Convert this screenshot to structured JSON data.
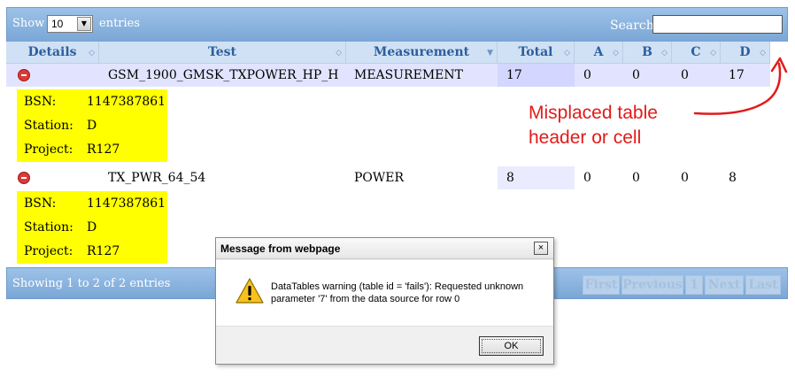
{
  "toolbar": {
    "show_label": "Show",
    "length_value": "10",
    "entries_label": "entries",
    "search_label": "Search:",
    "search_value": ""
  },
  "columns": [
    "Details",
    "Test",
    "Measurement",
    "Total",
    "A",
    "B",
    "C",
    "D"
  ],
  "rows": [
    {
      "test": "GSM_1900_GMSK_TXPOWER_HP_H",
      "measurement": "MEASUREMENT",
      "total": "17",
      "a": "0",
      "b": "0",
      "c": "0",
      "d": "17",
      "details": {
        "bsn_label": "BSN:",
        "bsn": "1147387861",
        "station_label": "Station:",
        "station": "D",
        "project_label": "Project:",
        "project": "R127"
      }
    },
    {
      "test": "TX_PWR_64_54",
      "measurement": "POWER",
      "total": "8",
      "a": "0",
      "b": "0",
      "c": "0",
      "d": "8",
      "details": {
        "bsn_label": "BSN:",
        "bsn": "1147387861",
        "station_label": "Station:",
        "station": "D",
        "project_label": "Project:",
        "project": "R127"
      }
    }
  ],
  "footer": {
    "info": "Showing 1 to 2 of 2 entries",
    "first": "First",
    "previous": "Previous",
    "page": "1",
    "next": "Next",
    "last": "Last"
  },
  "annotation": {
    "line1": "Misplaced table",
    "line2": "header or cell",
    "color": "#e21a1a"
  },
  "dialog": {
    "title": "Message from webpage",
    "close": "×",
    "message": "DataTables warning (table id = 'fails'): Requested unknown parameter '7' from the data source for row 0",
    "ok": "OK",
    "icon": "warning-icon"
  },
  "colors": {
    "header_bar": "#7aa6d6",
    "column_header_text": "#2b5f9c",
    "detail_bg": "#ffff00"
  }
}
